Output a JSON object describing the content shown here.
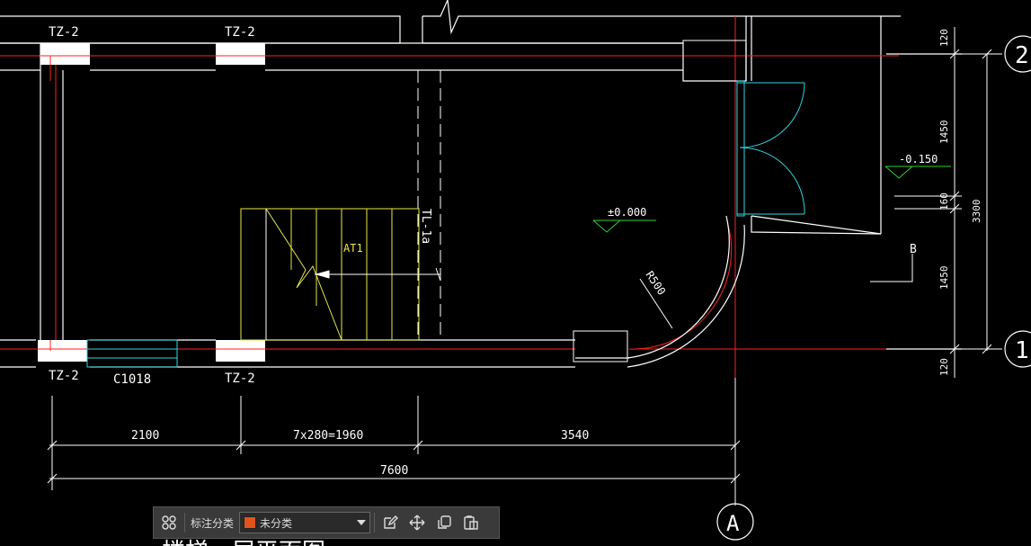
{
  "drawing": {
    "columns": {
      "top_left": "TZ-2",
      "top_mid": "TZ-2",
      "bottom_left": "TZ-2",
      "bottom_mid": "TZ-2"
    },
    "window_label": "C1018",
    "beam_label": "TL-1a",
    "stair_label": "AT1",
    "elevation_main": "±0.000",
    "elevation_side": "-0.150",
    "radius_label": "R500",
    "section_label": "B",
    "dimensions_bottom": {
      "d1": "2100",
      "d2": "7x280=1960",
      "d3": "3540",
      "total": "7600"
    },
    "dimensions_right": {
      "top": "120",
      "upper": "1450",
      "mid": "160",
      "lower": "1450",
      "bottom": "120",
      "total": "3300"
    },
    "axes": {
      "axis_2": "2",
      "axis_1": "1",
      "axis_a": "A"
    },
    "partial_bottom_text": "楼梯一层平面图"
  },
  "toolbar": {
    "category_label": "标注分类",
    "select_value": "未分类",
    "swatch_color": "#e2541b",
    "icons": [
      "grid-icon",
      "edit-icon",
      "move-icon",
      "copy-icon",
      "paste-icon"
    ]
  },
  "colors": {
    "line_white": "#ffffff",
    "line_red": "#ff2020",
    "line_cyan": "#2fd6e0",
    "line_yellow": "#e8e84a",
    "line_green": "#30d030"
  }
}
